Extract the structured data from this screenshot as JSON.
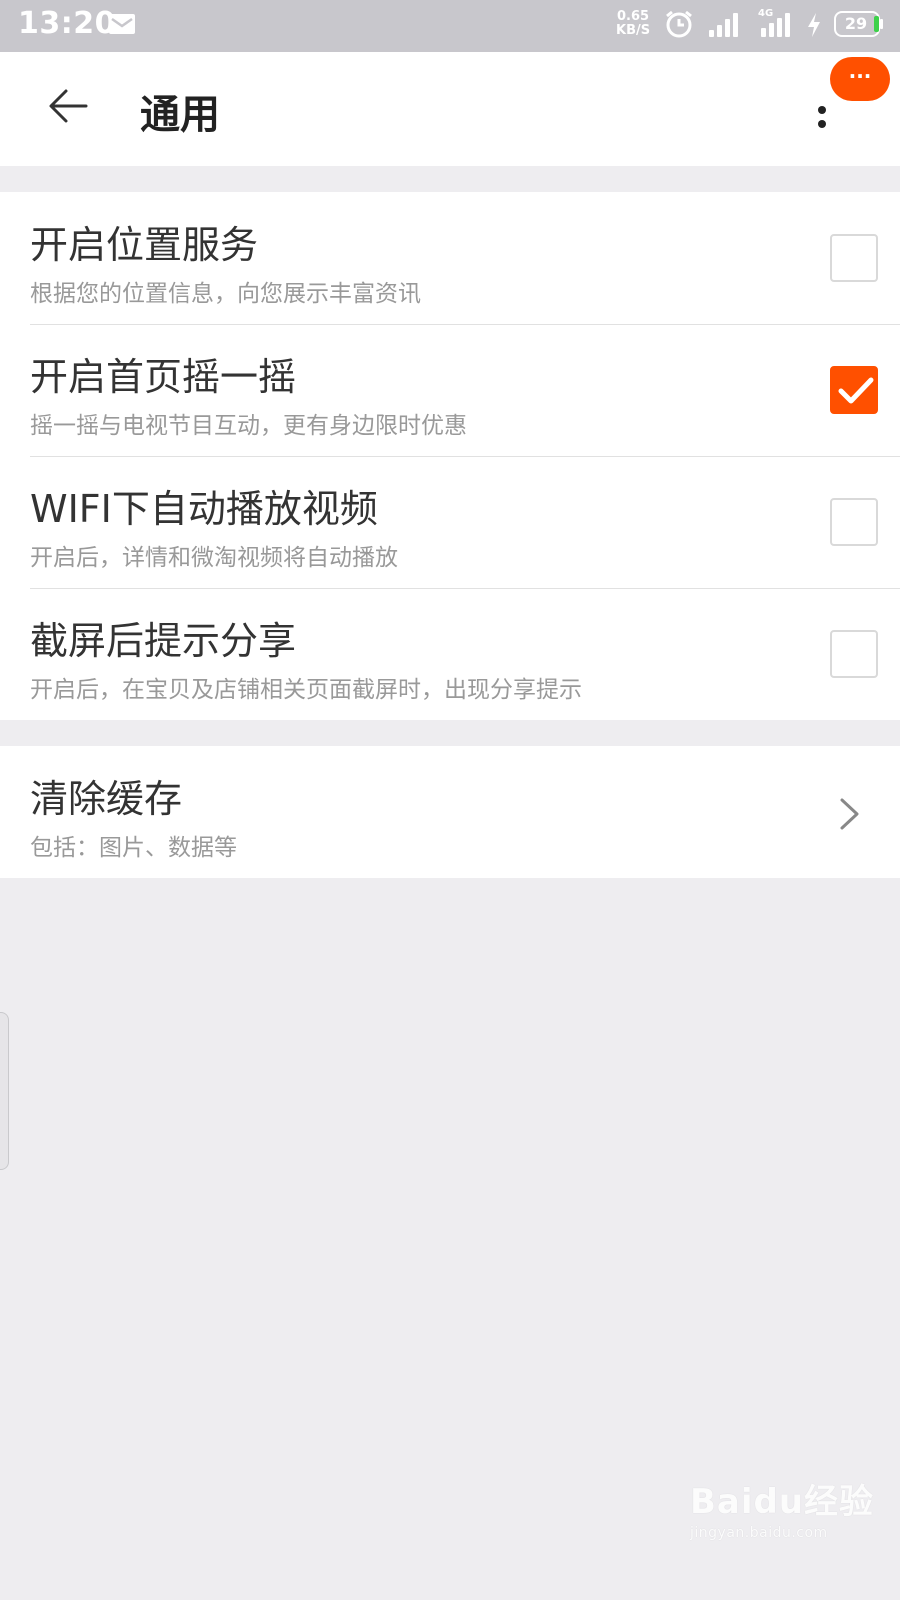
{
  "status_bar": {
    "time": "13:20",
    "network_speed_value": "0.65",
    "network_speed_unit": "KB/S",
    "network_type": "4G",
    "battery": "29",
    "icons": [
      "message-icon",
      "alarm-icon",
      "signal-icon",
      "signal-4g-icon",
      "charging-icon",
      "battery-icon"
    ]
  },
  "header": {
    "title": "通用",
    "back_icon": "back-arrow-icon",
    "more_icon": "more-vertical-icon",
    "badge_text": "···"
  },
  "settings": [
    {
      "title": "开启位置服务",
      "subtitle": "根据您的位置信息，向您展示丰富资讯",
      "checked": false
    },
    {
      "title": "开启首页摇一摇",
      "subtitle": "摇一摇与电视节目互动，更有身边限时优惠",
      "checked": true
    },
    {
      "title": "WIFI下自动播放视频",
      "subtitle": "开启后，详情和微淘视频将自动播放",
      "checked": false
    },
    {
      "title": "截屏后提示分享",
      "subtitle": "开启后，在宝贝及店铺相关页面截屏时，出现分享提示",
      "checked": false
    }
  ],
  "cache": {
    "title": "清除缓存",
    "subtitle": "包括：图片、数据等",
    "icon": "chevron-right-icon"
  },
  "watermark": {
    "main": "Baidu经验",
    "sub": "jingyan.baidu.com"
  },
  "colors": {
    "accent": "#ff5000",
    "status_bar": "#c8c7cc",
    "background": "#eeedf0"
  }
}
